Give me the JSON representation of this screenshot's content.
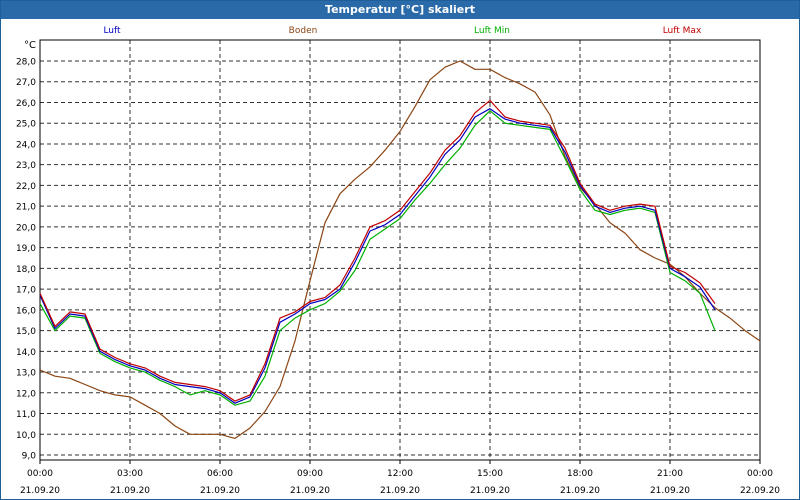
{
  "window": {
    "title": "Temperatur [°C] skaliert"
  },
  "chart_data": {
    "type": "line",
    "title": "Temperatur [°C] skaliert",
    "ylabel": "°C",
    "xlabel": "",
    "ylim": [
      9.0,
      28.0
    ],
    "yticks": [
      "28,0",
      "27,0",
      "26,0",
      "25,0",
      "24,0",
      "23,0",
      "22,0",
      "21,0",
      "20,0",
      "19,0",
      "18,0",
      "17,0",
      "16,0",
      "15,0",
      "14,0",
      "13,0",
      "12,0",
      "11,0",
      "10,0",
      "9,0"
    ],
    "xticks": [
      {
        "time": "00:00",
        "date": "21.09.20"
      },
      {
        "time": "03:00",
        "date": "21.09.20"
      },
      {
        "time": "06:00",
        "date": "21.09.20"
      },
      {
        "time": "09:00",
        "date": "21.09.20"
      },
      {
        "time": "12:00",
        "date": "21.09.20"
      },
      {
        "time": "15:00",
        "date": "21.09.20"
      },
      {
        "time": "18:00",
        "date": "21.09.20"
      },
      {
        "time": "21:00",
        "date": "21.09.20"
      },
      {
        "time": "00:00",
        "date": "22.09.20"
      }
    ],
    "grid": true,
    "legend_position": "top",
    "x_hours": [
      0,
      0.5,
      1,
      1.5,
      2,
      2.5,
      3,
      3.5,
      4,
      4.5,
      5,
      5.5,
      6,
      6.5,
      7,
      7.5,
      8,
      8.5,
      9,
      9.5,
      10,
      10.5,
      11,
      11.5,
      12,
      12.5,
      13,
      13.5,
      14,
      14.5,
      15,
      15.5,
      16,
      16.5,
      17,
      17.5,
      18,
      18.5,
      19,
      19.5,
      20,
      20.5,
      21,
      21.5,
      22,
      22.5,
      23,
      23.5,
      24
    ],
    "series": [
      {
        "name": "Luft",
        "color": "#0000c0",
        "values": [
          16.7,
          15.1,
          15.8,
          15.7,
          14.0,
          13.6,
          13.3,
          13.1,
          12.7,
          12.4,
          12.3,
          12.2,
          12.0,
          11.5,
          11.8,
          13.2,
          15.4,
          15.8,
          16.3,
          16.5,
          17.0,
          18.3,
          19.8,
          20.1,
          20.6,
          21.5,
          22.4,
          23.5,
          24.2,
          25.3,
          25.7,
          25.2,
          25.0,
          24.9,
          24.8,
          23.6,
          22.0,
          21.0,
          20.7,
          20.9,
          21.0,
          20.8,
          18.0,
          17.6,
          17.1,
          16.0
        ],
        "x_hours_count": 46
      },
      {
        "name": "Boden",
        "color": "#8b4513",
        "values": [
          13.1,
          12.8,
          12.7,
          12.4,
          12.1,
          11.9,
          11.8,
          11.4,
          11.0,
          10.4,
          10.0,
          10.0,
          10.0,
          9.8,
          10.3,
          11.1,
          12.3,
          14.5,
          17.4,
          20.2,
          21.6,
          22.3,
          22.9,
          23.7,
          24.6,
          25.8,
          27.1,
          27.7,
          28.0,
          27.6,
          27.6,
          27.2,
          26.9,
          26.5,
          25.4,
          23.4,
          21.9,
          21.1,
          20.2,
          19.7,
          18.9,
          18.5,
          18.2,
          17.6,
          16.8,
          16.1,
          15.6,
          15.0,
          14.5
        ],
        "x_hours_count": 49
      },
      {
        "name": "Luft Min",
        "color": "#00b000",
        "values": [
          16.3,
          15.0,
          15.7,
          15.6,
          13.9,
          13.5,
          13.2,
          13.0,
          12.6,
          12.3,
          11.9,
          12.1,
          11.9,
          11.4,
          11.6,
          12.8,
          15.0,
          15.6,
          16.0,
          16.3,
          16.9,
          17.9,
          19.4,
          19.9,
          20.4,
          21.3,
          22.1,
          23.0,
          23.8,
          24.9,
          25.6,
          25.0,
          24.9,
          24.8,
          24.7,
          23.3,
          21.8,
          20.8,
          20.6,
          20.8,
          20.9,
          20.7,
          17.8,
          17.4,
          16.8,
          15.0
        ],
        "x_hours_count": 46
      },
      {
        "name": "Luft Max",
        "color": "#c00000",
        "values": [
          16.8,
          15.2,
          15.9,
          15.8,
          14.1,
          13.7,
          13.4,
          13.2,
          12.8,
          12.5,
          12.4,
          12.3,
          12.1,
          11.6,
          11.9,
          13.4,
          15.6,
          15.9,
          16.4,
          16.6,
          17.2,
          18.5,
          20.0,
          20.3,
          20.8,
          21.7,
          22.6,
          23.7,
          24.4,
          25.5,
          26.1,
          25.3,
          25.1,
          25.0,
          24.9,
          23.8,
          22.1,
          21.1,
          20.8,
          21.0,
          21.1,
          21.0,
          18.1,
          17.8,
          17.3,
          16.3
        ],
        "x_hours_count": 46
      }
    ]
  }
}
